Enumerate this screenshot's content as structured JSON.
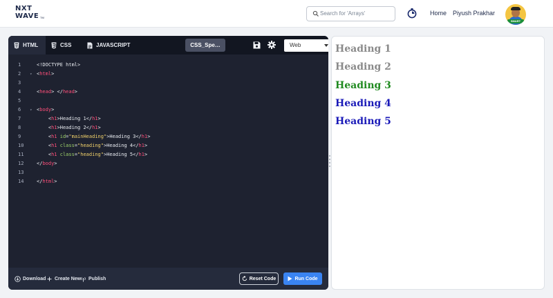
{
  "header": {
    "logo_line1": "NXT",
    "logo_line2": "WAVE",
    "logo_tm": "TM",
    "search_placeholder": "Search for 'Arrays'",
    "nav_home": "Home",
    "user_name": "Piyush Prakhar",
    "avatar_badge": "SMART"
  },
  "editor": {
    "tabs": [
      {
        "label": "HTML",
        "icon": "html-file-icon",
        "active": true
      },
      {
        "label": "CSS",
        "icon": "css-file-icon",
        "active": false
      },
      {
        "label": "JAVASCRIPT",
        "icon": "js-file-icon",
        "active": false
      }
    ],
    "filename": "CSS_Spe…",
    "target_select": "Web",
    "code_lines": [
      {
        "n": "1",
        "fold": "",
        "src": "<!DOCTYPE html>"
      },
      {
        "n": "2",
        "fold": "▾",
        "src": "<html>"
      },
      {
        "n": "3",
        "fold": "",
        "src": ""
      },
      {
        "n": "4",
        "fold": "",
        "src": "<head> </head>"
      },
      {
        "n": "5",
        "fold": "",
        "src": ""
      },
      {
        "n": "6",
        "fold": "▾",
        "src": "<body>"
      },
      {
        "n": "7",
        "fold": "",
        "src": "    <h1>Heading 1</h1>"
      },
      {
        "n": "8",
        "fold": "",
        "src": "    <h1>Heading 2</h1>"
      },
      {
        "n": "9",
        "fold": "",
        "src": "    <h1 id=\"mainHeading\">Heading 3</h1>"
      },
      {
        "n": "10",
        "fold": "",
        "src": "    <h1 class=\"heading\">Heading 4</h1>"
      },
      {
        "n": "11",
        "fold": "",
        "src": "    <h1 class=\"heading\">Heading 5</h1>"
      },
      {
        "n": "12",
        "fold": "",
        "src": "</body>"
      },
      {
        "n": "13",
        "fold": "",
        "src": ""
      },
      {
        "n": "14",
        "fold": "",
        "src": "</html>"
      }
    ],
    "footer": {
      "download": "Download",
      "create_new": "Create New",
      "publish": "Publish",
      "reset": "Reset Code",
      "run": "Run Code"
    }
  },
  "preview": {
    "headings": [
      {
        "text": "Heading 1",
        "color": "#8a8a8a"
      },
      {
        "text": "Heading 2",
        "color": "#8a8a8a"
      },
      {
        "text": "Heading 3",
        "color": "#1f8a1f"
      },
      {
        "text": "Heading 4",
        "color": "#1a1ab8"
      },
      {
        "text": "Heading 5",
        "color": "#1a1ab8"
      }
    ]
  },
  "colors": {
    "editor_bg": "#1e2230",
    "tag": "#ff4f7a",
    "attr": "#9fd36a",
    "string": "#f3d36b",
    "run_button": "#3a84f2"
  }
}
